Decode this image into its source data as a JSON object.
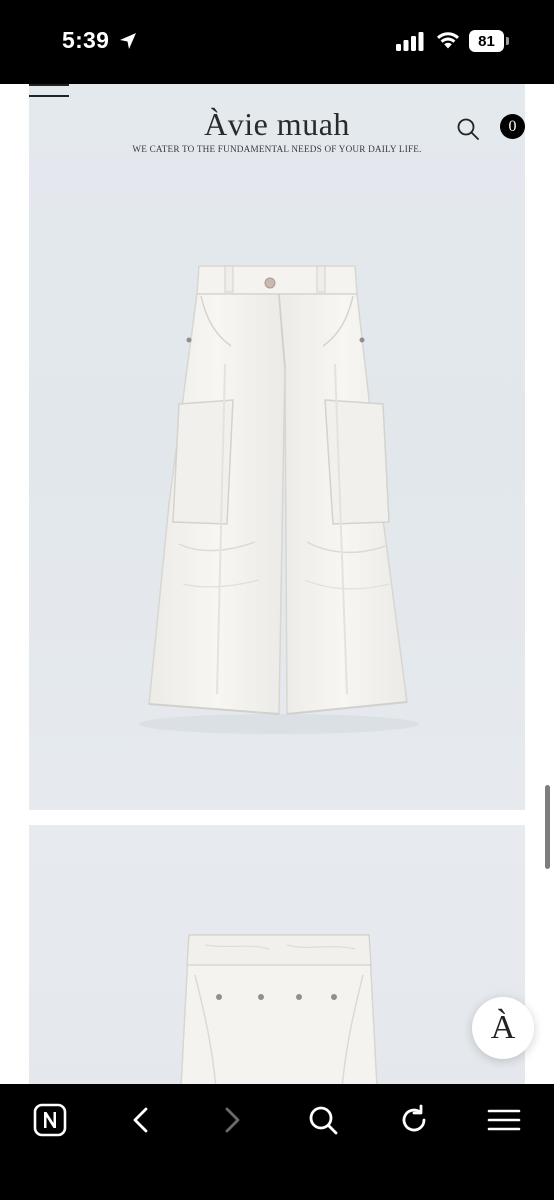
{
  "status_bar": {
    "time": "5:39",
    "battery_level": "81",
    "icons": [
      "location-arrow-icon",
      "cellular-signal-icon",
      "wifi-icon",
      "battery-icon"
    ]
  },
  "site_header": {
    "logo": "Àvie muah",
    "tagline": "WE CATER TO THE FUNDAMENTAL NEEDS OF YOUR DAILY LIFE.",
    "cart_count": "0",
    "icons": [
      "hamburger-menu-icon",
      "search-icon"
    ]
  },
  "product_gallery": {
    "images": [
      {
        "subject": "white cargo pants, front view"
      },
      {
        "subject": "white cargo pants, waistband detail"
      }
    ]
  },
  "floating_button": {
    "label": "À"
  },
  "browser_toolbar": {
    "icons": [
      "naver-app-icon",
      "back-icon",
      "forward-icon",
      "search-icon",
      "reload-icon",
      "menu-icon"
    ],
    "forward_enabled": false
  },
  "colors": {
    "photo_background": "#e3e8ec",
    "garment": "#f5f4f1",
    "toolbar": "#000000"
  }
}
